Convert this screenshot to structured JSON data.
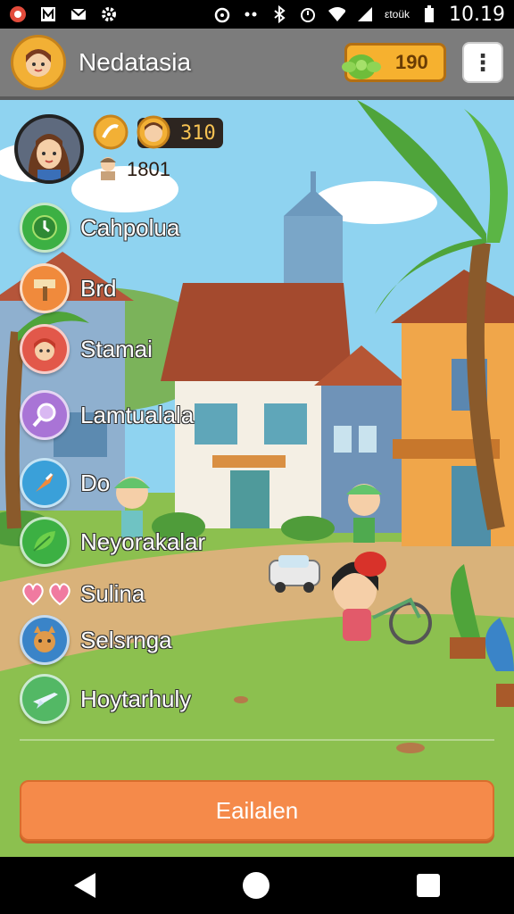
{
  "status_bar": {
    "time": "10.19",
    "network_text": "εtoük",
    "icons": [
      "app-icon",
      "notification-icon",
      "mail-icon",
      "settings-icon",
      "alarm-icon",
      "dots-icon",
      "bluetooth-icon",
      "timer-icon",
      "wifi-icon",
      "signal-icon",
      "battery-icon"
    ]
  },
  "header": {
    "town_name": "Nedatasia",
    "coins": "190",
    "menu_label": "⋮"
  },
  "profile": {
    "level_value": "310",
    "sub_value": "1801"
  },
  "menu": {
    "items": [
      {
        "label": "Cahpolua",
        "icon": "clock-icon",
        "color": "#3cb043"
      },
      {
        "label": "Brd",
        "icon": "hammer-icon",
        "color": "#f08a3c"
      },
      {
        "label": "Stamai",
        "icon": "character-icon",
        "color": "#e2584a"
      },
      {
        "label": "Lamtualala",
        "icon": "magnifier-icon",
        "color": "#a974d6"
      },
      {
        "label": "Do",
        "icon": "shovel-icon",
        "color": "#3aa0d9"
      },
      {
        "label": "Neyorakalar",
        "icon": "leaf-icon",
        "color": "#3cb043"
      },
      {
        "label": "Sulina",
        "icon": "hearts-icon",
        "color": "#f07aa0"
      },
      {
        "label": "Selsrnga",
        "icon": "cat-icon",
        "color": "#3a84c8"
      },
      {
        "label": "Hoytarhuly",
        "icon": "plane-icon",
        "color": "#53b865"
      }
    ]
  },
  "action_button": {
    "label": "Eailalen"
  },
  "colors": {
    "sky": "#8fd3f0",
    "grass": "#8cc04f",
    "path": "#d9b27a",
    "header": "#7c7c7c",
    "accent": "#f58a4a",
    "coin": "#f6b12f"
  }
}
